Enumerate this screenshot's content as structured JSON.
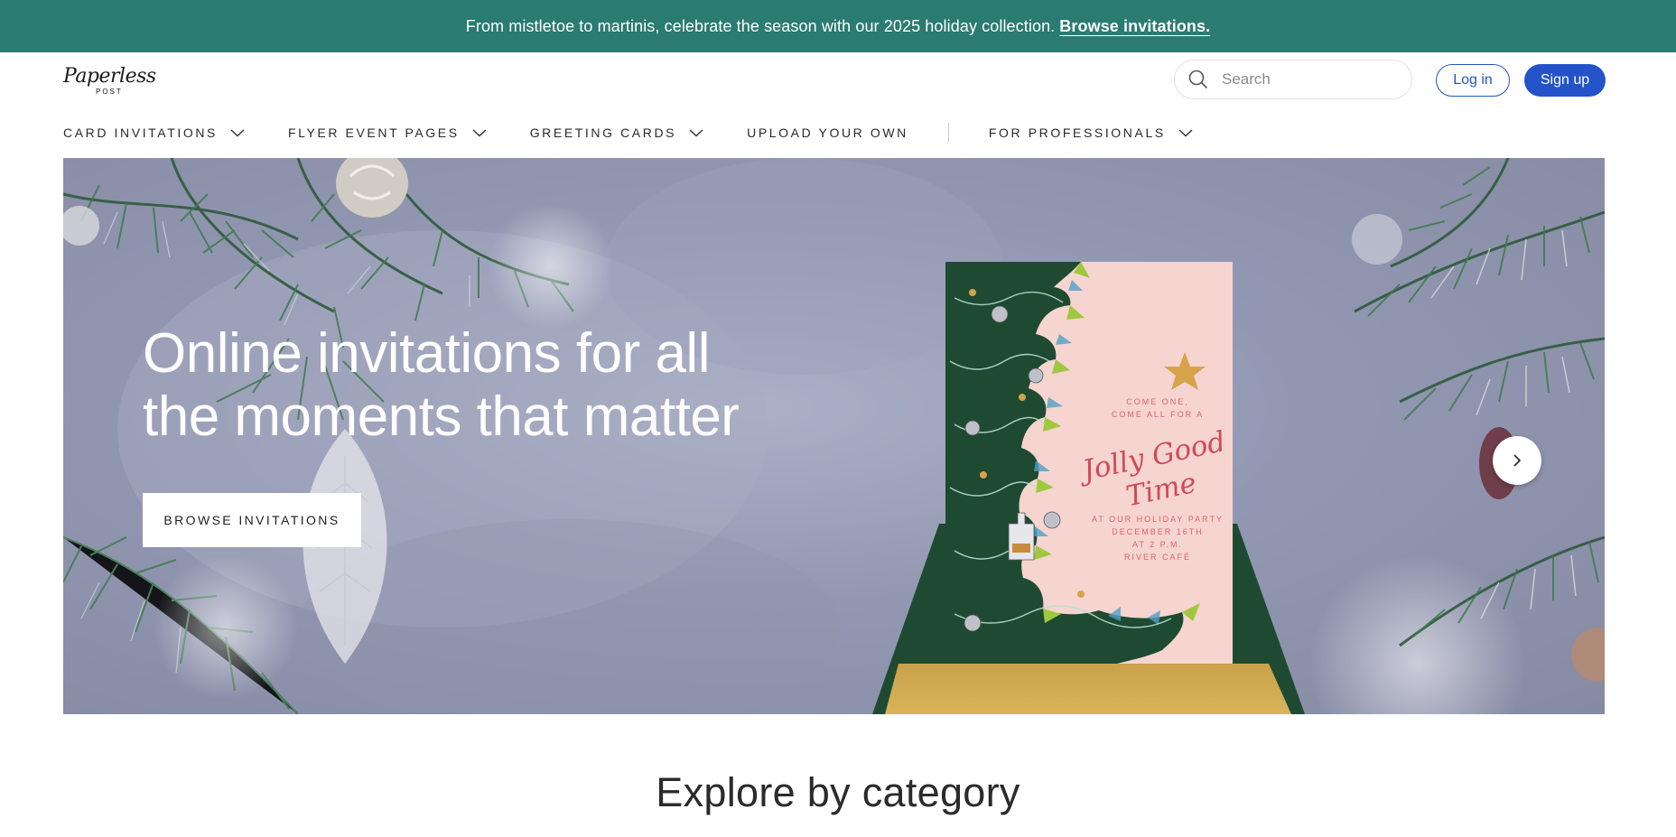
{
  "promo": {
    "text": "From mistletoe to martinis, celebrate the season with our 2025 holiday collection.",
    "link": "Browse invitations."
  },
  "brand": {
    "name": "Paperless",
    "sub": "POST"
  },
  "search": {
    "placeholder": "Search"
  },
  "auth": {
    "login": "Log in",
    "signup": "Sign up"
  },
  "nav": {
    "items": [
      {
        "label": "CARD INVITATIONS"
      },
      {
        "label": "FLYER EVENT PAGES"
      },
      {
        "label": "GREETING CARDS"
      },
      {
        "label": "UPLOAD YOUR OWN"
      },
      {
        "label": "FOR PROFESSIONALS"
      }
    ]
  },
  "hero": {
    "title_line1": "Online invitations for all",
    "title_line2": "the moments that matter",
    "cta": "BROWSE INVITATIONS",
    "card": {
      "intro_line1": "COME ONE,",
      "intro_line2": "COME ALL FOR A",
      "script_line1": "Jolly Good",
      "script_line2": "Time",
      "detail_line1": "AT OUR HOLIDAY PARTY",
      "detail_line2": "DECEMBER 16TH",
      "detail_line3": "AT 2 P.M.",
      "detail_line4": "RIVER CAFÉ"
    }
  },
  "section": {
    "title": "Explore by category"
  },
  "colors": {
    "promo_bg": "#2a7b72",
    "primary_blue": "#2453c9",
    "hero_bg": "#9398b2",
    "card_pink": "#f6d4cf",
    "tree_green": "#1f4a32"
  }
}
